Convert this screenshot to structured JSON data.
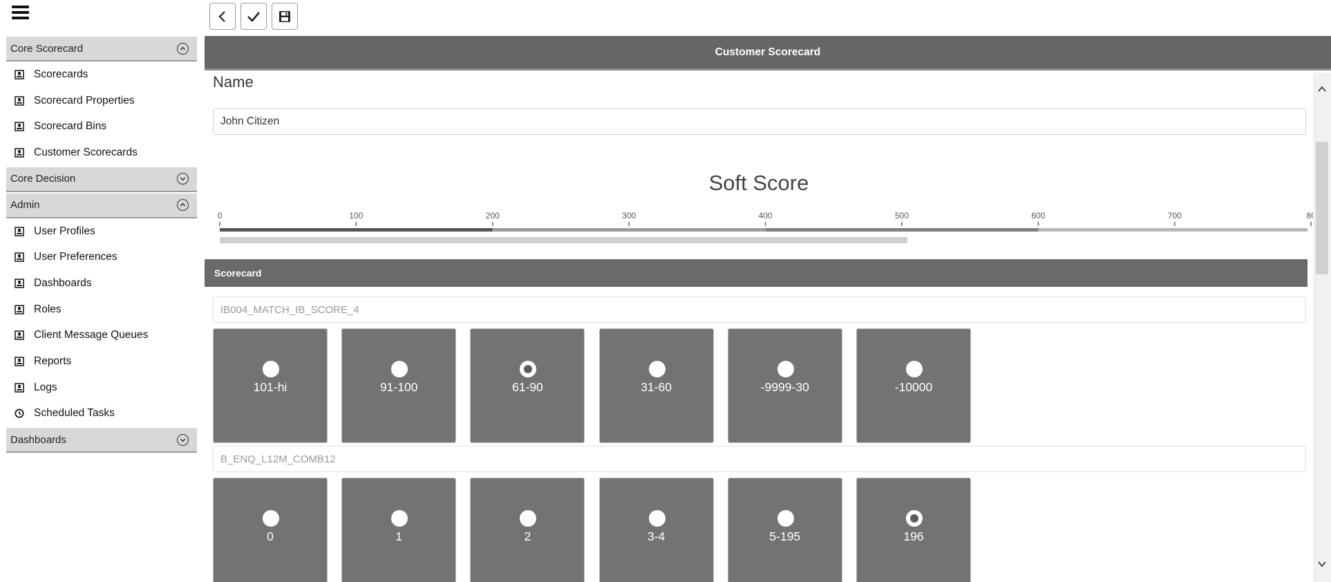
{
  "sidebar": {
    "sections": [
      {
        "title": "Core Scorecard",
        "expanded": true,
        "items": [
          {
            "label": "Scorecards",
            "icon": "document-icon"
          },
          {
            "label": "Scorecard Properties",
            "icon": "document-icon"
          },
          {
            "label": "Scorecard Bins",
            "icon": "document-icon"
          },
          {
            "label": "Customer Scorecards",
            "icon": "document-icon"
          }
        ]
      },
      {
        "title": "Core Decision",
        "expanded": false,
        "items": []
      },
      {
        "title": "Admin",
        "expanded": true,
        "items": [
          {
            "label": "User Profiles",
            "icon": "document-icon"
          },
          {
            "label": "User Preferences",
            "icon": "document-icon"
          },
          {
            "label": "Dashboards",
            "icon": "document-icon"
          },
          {
            "label": "Roles",
            "icon": "document-icon"
          },
          {
            "label": "Client Message Queues",
            "icon": "document-icon"
          },
          {
            "label": "Reports",
            "icon": "document-icon"
          },
          {
            "label": "Logs",
            "icon": "document-icon"
          },
          {
            "label": "Scheduled Tasks",
            "icon": "clock-icon"
          }
        ]
      },
      {
        "title": "Dashboards",
        "expanded": false,
        "items": []
      }
    ]
  },
  "toolbar": {
    "buttons": [
      {
        "name": "back-button",
        "icon": "chevron-left-icon"
      },
      {
        "name": "confirm-button",
        "icon": "checkmark-icon"
      },
      {
        "name": "save-button",
        "icon": "floppy-disk-icon"
      }
    ]
  },
  "page": {
    "title": "Customer Scorecard",
    "name_label": "Name",
    "name_value": "John Citizen"
  },
  "gauge": {
    "title": "Soft Score",
    "ticks": [
      "0",
      "100",
      "200",
      "300",
      "400",
      "500",
      "600",
      "700",
      "80"
    ],
    "score_value": 504,
    "bands": [
      {
        "to": 200,
        "color": "#555555"
      },
      {
        "to": 400,
        "color": "#9a9a9a"
      },
      {
        "to": 600,
        "color": "#7e7e7e"
      },
      {
        "to": 800,
        "color": "#b8b8b8"
      }
    ],
    "bar_color": "#cfcfcf"
  },
  "scorecard": {
    "header": "Scorecard",
    "groups": [
      {
        "label": "IB004_MATCH_IB_SCORE_4",
        "options": [
          {
            "label": "101-hi",
            "selected": false
          },
          {
            "label": "91-100",
            "selected": false
          },
          {
            "label": "61-90",
            "selected": true
          },
          {
            "label": "31-60",
            "selected": false
          },
          {
            "label": "-9999-30",
            "selected": false
          },
          {
            "label": "-10000",
            "selected": false
          }
        ]
      },
      {
        "label": "B_ENQ_L12M_COMB12",
        "options": [
          {
            "label": "0",
            "selected": false
          },
          {
            "label": "1",
            "selected": false
          },
          {
            "label": "2",
            "selected": false
          },
          {
            "label": "3-4",
            "selected": false
          },
          {
            "label": "5-195",
            "selected": false
          },
          {
            "label": "196",
            "selected": true
          }
        ]
      }
    ]
  }
}
